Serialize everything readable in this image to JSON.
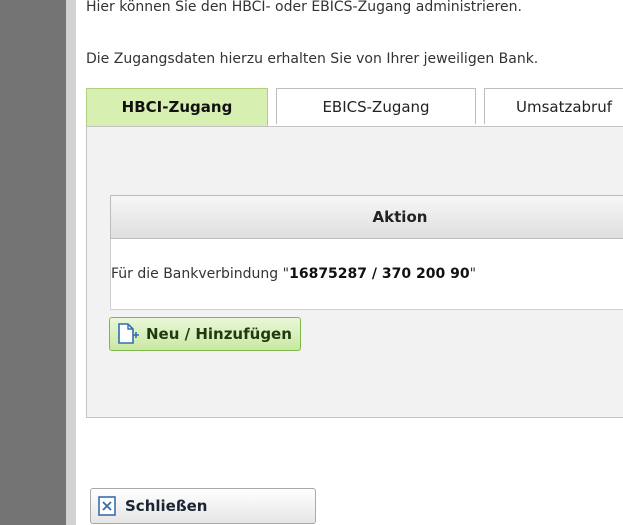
{
  "intro": {
    "line1": "Hier können Sie den HBCI- oder EBICS-Zugang administrieren.",
    "line2": "Die Zugangsdaten hierzu erhalten Sie von Ihrer jeweiligen Bank."
  },
  "tabs": [
    {
      "label": "HBCI-Zugang",
      "active": true
    },
    {
      "label": "EBICS-Zugang",
      "active": false
    },
    {
      "label": "Umsatzabruf",
      "active": false
    }
  ],
  "table": {
    "header": "Aktion",
    "row_prefix": "Für die Bankverbindung \"",
    "row_bold": "16875287 / 370 200 90",
    "row_suffix": "\""
  },
  "buttons": {
    "add_label": "Neu / Hinzufügen",
    "close_label": "Schließen"
  },
  "icons": {
    "add": "new-document-plus-icon",
    "close": "close-window-icon"
  },
  "colors": {
    "active_tab_bg": "#d8efb2",
    "add_button_border": "#7fb84a",
    "left_bar": "#747474"
  }
}
